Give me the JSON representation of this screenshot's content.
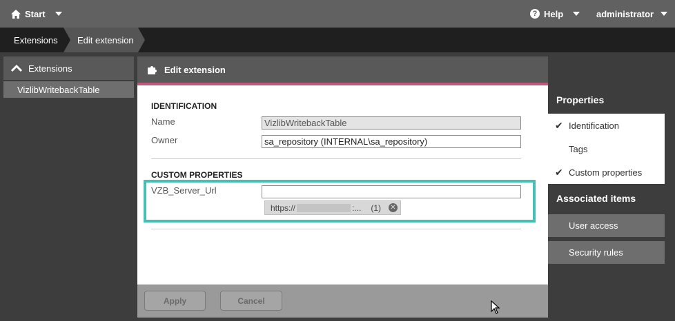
{
  "topbar": {
    "start_label": "Start",
    "help_label": "Help",
    "user_label": "administrator"
  },
  "breadcrumb": [
    "Extensions",
    "Edit extension"
  ],
  "sidebar": {
    "header_label": "Extensions",
    "items": [
      {
        "label": "VizlibWritebackTable"
      }
    ]
  },
  "main": {
    "title": "Edit extension",
    "identification": {
      "section_title": "IDENTIFICATION",
      "name_label": "Name",
      "name_value": "VizlibWritebackTable",
      "owner_label": "Owner",
      "owner_value": "sa_repository (INTERNAL\\sa_repository)"
    },
    "custom_properties": {
      "section_title": "CUSTOM PROPERTIES",
      "field_label": "VZB_Server_Url",
      "field_value": "",
      "tag_prefix": "https://",
      "tag_suffix": ":...",
      "tag_count": "(1)"
    },
    "apply_label": "Apply",
    "cancel_label": "Cancel"
  },
  "properties_panel": {
    "properties_title": "Properties",
    "properties_items": [
      {
        "label": "Identification",
        "checked": true
      },
      {
        "label": "Tags",
        "checked": false
      },
      {
        "label": "Custom properties",
        "checked": true
      }
    ],
    "associated_title": "Associated items",
    "associated_items": [
      {
        "label": "User access"
      },
      {
        "label": "Security rules"
      }
    ]
  },
  "colors": {
    "accent": "#c0567a",
    "highlight": "#47c0b3"
  }
}
